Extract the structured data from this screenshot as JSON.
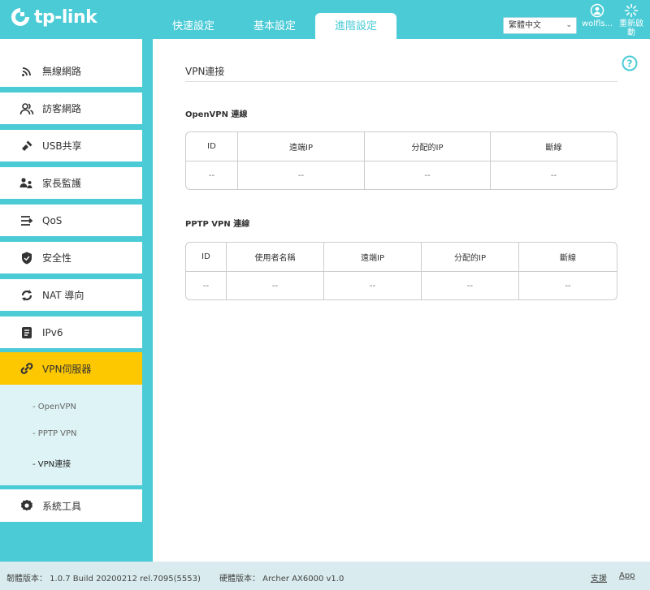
{
  "brand": {
    "logo_text": "tp-link"
  },
  "nav": {
    "tabs": [
      {
        "label": "快速設定"
      },
      {
        "label": "基本設定"
      },
      {
        "label": "進階設定"
      }
    ],
    "language": "繁體中文",
    "user_label": "wolfls...",
    "reboot_label_1": "重新啟",
    "reboot_label_2": "動"
  },
  "sidebar": {
    "items": [
      {
        "label": "無線網路",
        "icon": "wifi-icon"
      },
      {
        "label": "訪客網路",
        "icon": "guest-users-icon"
      },
      {
        "label": "USB共享",
        "icon": "usb-icon"
      },
      {
        "label": "家長監護",
        "icon": "parental-control-icon"
      },
      {
        "label": "QoS",
        "icon": "qos-icon"
      },
      {
        "label": "安全性",
        "icon": "shield-icon"
      },
      {
        "label": "NAT 導向",
        "icon": "nat-icon"
      },
      {
        "label": "IPv6",
        "icon": "ipv6-icon"
      },
      {
        "label": "VPN伺服器",
        "icon": "link-icon"
      },
      {
        "label": "系統工具",
        "icon": "gear-icon"
      }
    ],
    "sub_items": [
      {
        "label": "- OpenVPN"
      },
      {
        "label": "- PPTP VPN"
      },
      {
        "label": "- VPN連接"
      }
    ]
  },
  "main": {
    "title": "VPN連接",
    "openvpn": {
      "label": "OpenVPN 連線",
      "headers": [
        "ID",
        "遠端IP",
        "分配的IP",
        "斷線"
      ],
      "row": [
        "--",
        "--",
        "--",
        "--"
      ]
    },
    "pptp": {
      "label": "PPTP VPN 連線",
      "headers": [
        "ID",
        "使用者名稱",
        "遠端IP",
        "分配的IP",
        "斷線"
      ],
      "row": [
        "--",
        "--",
        "--",
        "--",
        "--"
      ]
    }
  },
  "footer": {
    "firmware": "韌體版本： 1.0.7 Build 20200212 rel.7095(5553)",
    "hardware": "硬體版本： Archer AX6000 v1.0",
    "support": "支援",
    "app": "App"
  },
  "colors": {
    "accent": "#4acbd6",
    "active": "#fdc800"
  }
}
